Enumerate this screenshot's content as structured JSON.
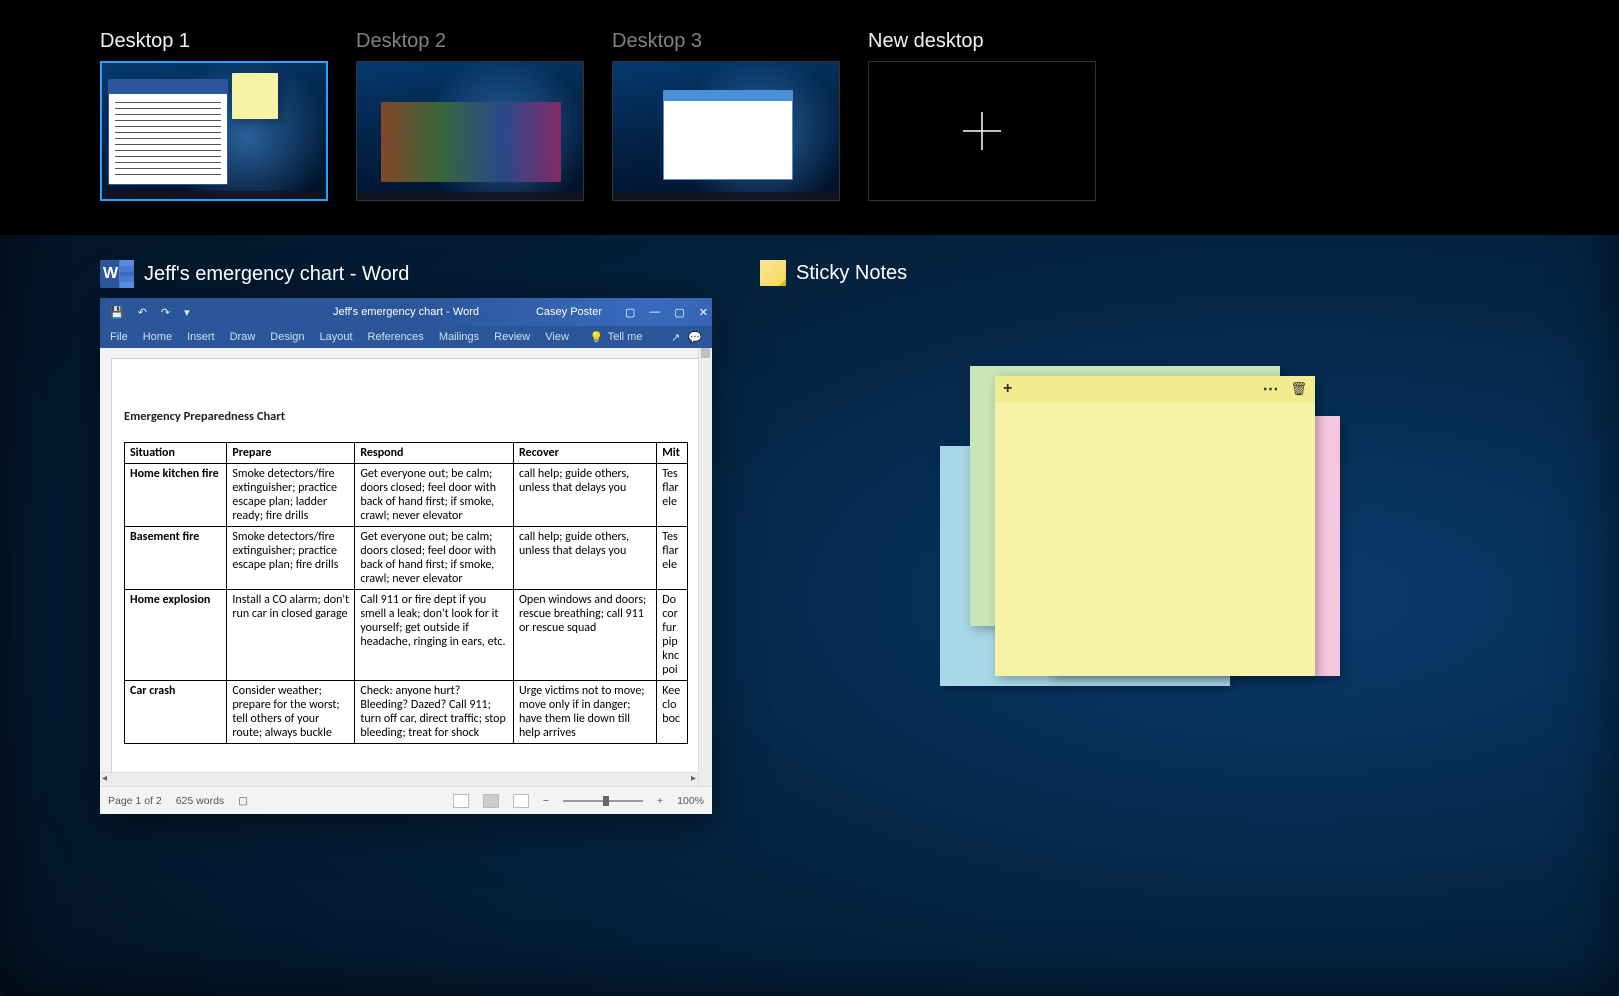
{
  "desktops": {
    "d1": "Desktop 1",
    "d2": "Desktop 2",
    "d3": "Desktop 3",
    "new": "New desktop"
  },
  "windows": {
    "word_title": "Jeff's emergency chart - Word",
    "sticky_title": "Sticky Notes"
  },
  "word": {
    "titlebar": "Jeff's emergency chart  -  Word",
    "user": "Casey Poster",
    "qat": {
      "save": "💾",
      "undo": "↶",
      "redo": "↷",
      "more": "▾"
    },
    "sys": {
      "ribbon": "▢",
      "min": "—",
      "max": "▢",
      "close": "✕"
    },
    "tabs": {
      "file": "File",
      "home": "Home",
      "insert": "Insert",
      "draw": "Draw",
      "design": "Design",
      "layout": "Layout",
      "references": "References",
      "mailings": "Mailings",
      "review": "Review",
      "view": "View",
      "tellme": "Tell me"
    },
    "doc_title": "Emergency Preparedness Chart",
    "headers": {
      "situation": "Situation",
      "prepare": "Prepare",
      "respond": "Respond",
      "recover": "Recover",
      "mitigate": "Mit"
    },
    "rows": [
      {
        "sit": "Home kitchen fire",
        "prep": "Smoke detectors/fire extinguisher; practice escape plan; ladder ready; fire drills",
        "resp": "Get everyone out; be calm; doors closed; feel door with back of hand first; if smoke, crawl; never elevator",
        "rec": "call help; guide others, unless that delays you",
        "mit": "Tes flar ele"
      },
      {
        "sit": "Basement fire",
        "prep": "Smoke detectors/fire extinguisher; practice escape plan; fire drills",
        "resp": "Get everyone out; be calm; doors closed; feel door with back of hand first; if smoke, crawl; never elevator",
        "rec": "call help; guide others, unless that delays you",
        "mit": "Tes flar ele"
      },
      {
        "sit": "Home explosion",
        "prep": "Install a CO alarm; don't run car in closed garage",
        "resp": "Call 911 or fire dept if you smell a leak; don't look for it yourself; get outside if headache, ringing in ears, etc.",
        "rec": "Open windows and doors; rescue breathing; call 911 or rescue squad",
        "mit": "Do cor fur pip knc poi"
      },
      {
        "sit": "Car crash",
        "prep": "Consider weather; prepare for the worst; tell others of your route; always buckle",
        "resp": "Check: anyone hurt? Bleeding? Dazed? Call 911; turn off car, direct traffic; stop bleeding; treat for shock",
        "rec": "Urge victims not to move; move only if in danger; have them lie down till help arrives",
        "mit": "Kee clo boc"
      }
    ],
    "status": {
      "page": "Page 1 of 2",
      "words": "625 words",
      "zoom_minus": "−",
      "zoom_plus": "+",
      "zoom": "100%"
    }
  },
  "sticky": {
    "add": "+",
    "menu": "⋯",
    "delete": "🗑"
  }
}
